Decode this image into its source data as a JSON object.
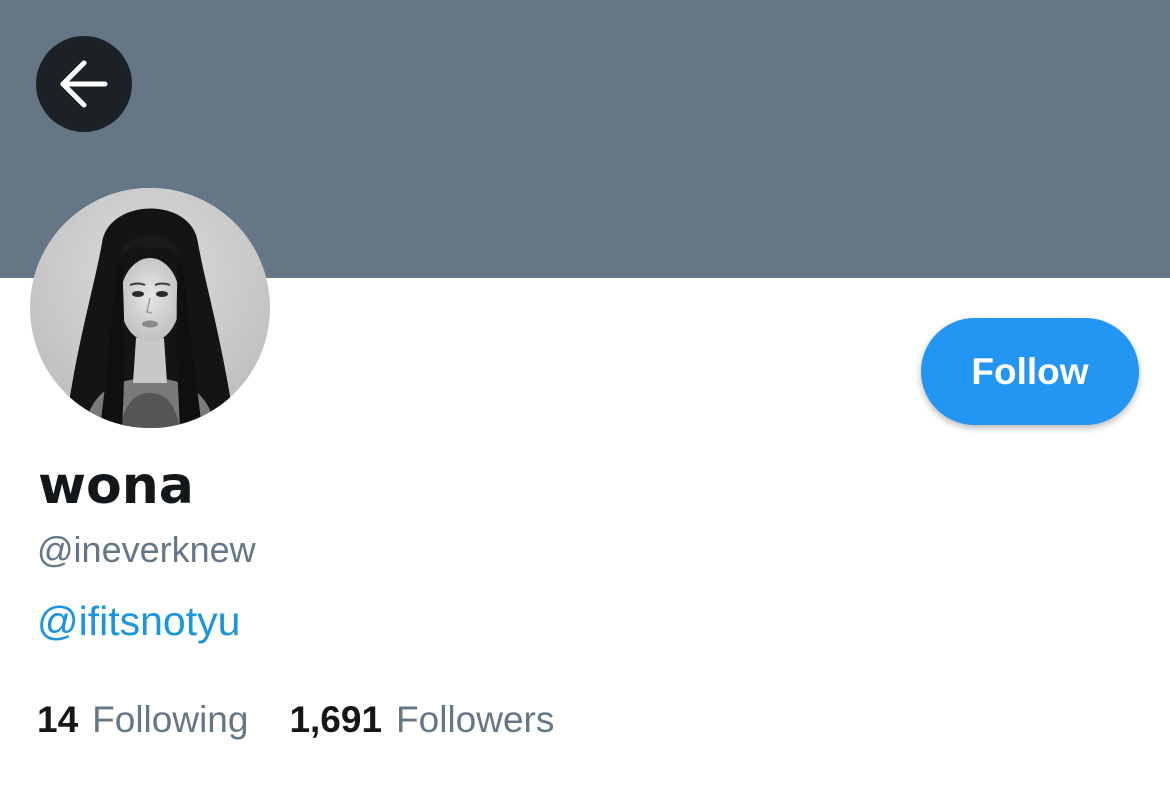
{
  "header": {
    "banner_color": "#657786",
    "back_icon": "arrow-left-icon"
  },
  "profile": {
    "avatar_icon": "profile-photo",
    "follow_label": "Follow",
    "display_name": "wona",
    "handle": "@ineverknew",
    "bio_link": "@ifitsnotyu"
  },
  "stats": {
    "following_count": "14",
    "following_label": "Following",
    "followers_count": "1,691",
    "followers_label": "Followers"
  },
  "colors": {
    "accent": "#1b95e0",
    "follow_button": "#2396f3",
    "text_primary": "#14171a",
    "text_secondary": "#657786"
  }
}
